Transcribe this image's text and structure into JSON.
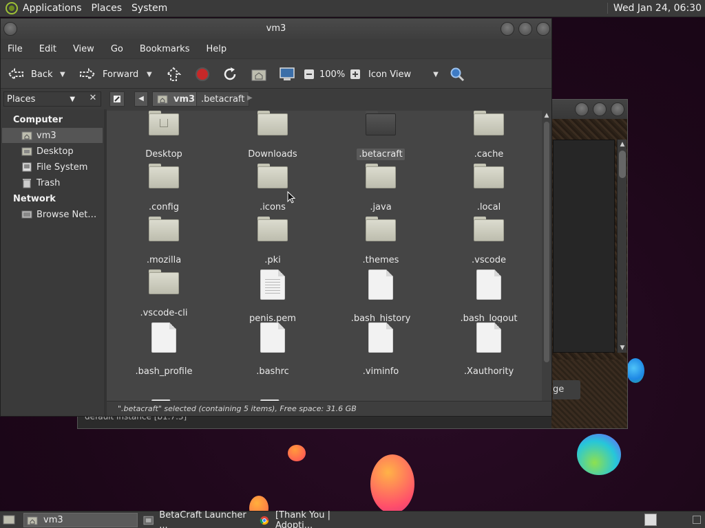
{
  "top_panel": {
    "menus": [
      "Applications",
      "Places",
      "System"
    ],
    "clock": "Wed Jan 24, 06:30"
  },
  "bg_window": {
    "manage_label": "ge",
    "instance_label": "default instance [b1.7.3]"
  },
  "window": {
    "title": "vm3",
    "menu": [
      "File",
      "Edit",
      "View",
      "Go",
      "Bookmarks",
      "Help"
    ]
  },
  "toolbar": {
    "back": "Back",
    "forward": "Forward",
    "zoom": "100%",
    "view_mode": "Icon View"
  },
  "pathbar": {
    "crumbs": [
      "vm3",
      ".betacraft"
    ]
  },
  "sidebar": {
    "header": "Places",
    "sections": [
      {
        "title": "Computer",
        "items": [
          "vm3",
          "Desktop",
          "File System",
          "Trash"
        ]
      },
      {
        "title": "Network",
        "items": [
          "Browse Net…"
        ]
      }
    ]
  },
  "files": [
    {
      "name": "Desktop",
      "kind": "folder-home"
    },
    {
      "name": "Downloads",
      "kind": "folder"
    },
    {
      "name": ".betacraft",
      "kind": "folder-dark",
      "selected": true
    },
    {
      "name": ".cache",
      "kind": "folder"
    },
    {
      "name": ".config",
      "kind": "folder"
    },
    {
      "name": ".icons",
      "kind": "folder"
    },
    {
      "name": ".java",
      "kind": "folder"
    },
    {
      "name": ".local",
      "kind": "folder"
    },
    {
      "name": ".mozilla",
      "kind": "folder"
    },
    {
      "name": ".pki",
      "kind": "folder"
    },
    {
      "name": ".themes",
      "kind": "folder"
    },
    {
      "name": ".vscode",
      "kind": "folder"
    },
    {
      "name": ".vscode-cli",
      "kind": "folder"
    },
    {
      "name": "penis.pem",
      "kind": "text"
    },
    {
      "name": ".bash_history",
      "kind": "file"
    },
    {
      "name": ".bash_logout",
      "kind": "file"
    },
    {
      "name": ".bash_profile",
      "kind": "file"
    },
    {
      "name": ".bashrc",
      "kind": "file"
    },
    {
      "name": ".viminfo",
      "kind": "file"
    },
    {
      "name": ".Xauthority",
      "kind": "file"
    }
  ],
  "status": "\".betacraft\" selected (containing 5 items), Free space: 31.6 GB",
  "taskbar": {
    "tasks": [
      "vm3",
      "BetaCraft Launcher ...",
      "[Thank You | Adopti..."
    ]
  },
  "colors": {
    "panel": "#3a3a3a",
    "window_bg": "#454545",
    "desktop": "#1f0a1c"
  }
}
